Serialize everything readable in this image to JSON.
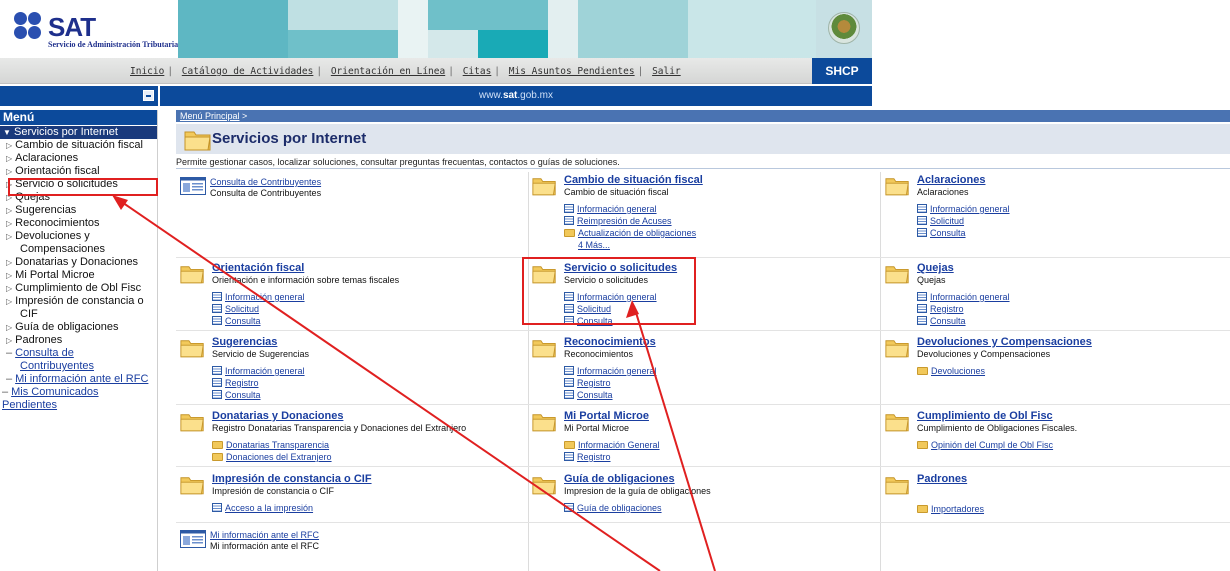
{
  "logo": {
    "name": "SAT",
    "subtitle": "Servicio de Administración Tributaria",
    "brand_color": "#1e2f8c"
  },
  "header": {
    "nav": [
      "Inicio",
      "Catálogo de Actividades",
      "Orientación en Línea",
      "Citas",
      "Mis Asuntos Pendientes",
      "Salir"
    ],
    "badge": "SHCP",
    "url_prefix": "www.",
    "url_brand": "sat",
    "url_suffix": ".gob.mx",
    "accent": "#0c4a9b"
  },
  "sidebar": {
    "title": "Menú",
    "section": "Servicios por Internet",
    "items": [
      "Cambio de situación fiscal",
      "Aclaraciones",
      "Orientación fiscal",
      "Servicio o solicitudes",
      "Quejas",
      "Sugerencias",
      "Reconocimientos",
      "Devoluciones y",
      "Compensaciones",
      "Donatarias y Donaciones",
      "Mi Portal Microe",
      "Cumplimiento de Obl Fisc",
      "Impresión de constancia o",
      "CIF",
      "Guía de obligaciones",
      "Padrones"
    ],
    "links": [
      "Consulta de",
      "Contribuyentes",
      "Mi información ante el RFC"
    ],
    "bottom_links": [
      "Mis Comunicados",
      "Pendientes"
    ]
  },
  "main": {
    "breadcrumb": "Menú Principal",
    "breadcrumb_sep": ">",
    "title": "Servicios por Internet",
    "description": "Permite gestionar casos, localizar soluciones, consultar preguntas frecuentas, contactos o guías de soluciones.",
    "cells": [
      {
        "title": "Consulta de Contribuyentes",
        "desc": "Consulta de Contribuyentes",
        "links": []
      },
      {
        "title": "Cambio de situación fiscal",
        "desc": "Cambio de situación fiscal",
        "links": [
          "Información general",
          "Reimpresión de Acuses",
          "Actualización de obligaciones"
        ],
        "more": "4 Más..."
      },
      {
        "title": "Aclaraciones",
        "desc": "Aclaraciones",
        "links": [
          "Información general",
          "Solicitud",
          "Consulta"
        ]
      },
      {
        "title": "Orientación fiscal",
        "desc": "Orientación e información sobre temas fiscales",
        "links": [
          "Información general",
          "Solicitud",
          "Consulta"
        ]
      },
      {
        "title": "Servicio o solicitudes",
        "desc": "Servicio o solicitudes",
        "links": [
          "Información general",
          "Solicitud",
          "Consulta"
        ]
      },
      {
        "title": "Quejas",
        "desc": "Quejas",
        "links": [
          "Información general",
          "Registro",
          "Consulta"
        ]
      },
      {
        "title": "Sugerencias",
        "desc": "Servicio de Sugerencias",
        "links": [
          "Información general",
          "Registro",
          "Consulta"
        ]
      },
      {
        "title": "Reconocimientos",
        "desc": "Reconocimientos",
        "links": [
          "Información general",
          "Registro",
          "Consulta"
        ]
      },
      {
        "title": "Devoluciones y Compensaciones",
        "desc": "Devoluciones y Compensaciones",
        "links": [
          "Devoluciones"
        ]
      },
      {
        "title": "Donatarias y Donaciones",
        "desc": "Registro Donatarias Transparencia y Donaciones del Extranjero",
        "links": [
          "Donatarias Transparencia",
          "Donaciones del Extranjero"
        ]
      },
      {
        "title": "Mi Portal Microe",
        "desc": "Mi Portal Microe",
        "links": [
          "Información General",
          "Registro"
        ]
      },
      {
        "title": "Cumplimiento de Obl Fisc",
        "desc": "Cumplimiento de Obligaciones Fiscales.",
        "links": [
          "Opinión del Cumpl de Obl Fisc"
        ]
      },
      {
        "title": "Impresión de constancia o CIF",
        "desc": "Impresión de constancia o CIF",
        "links": [
          "Acceso a la impresión"
        ]
      },
      {
        "title": "Guía de obligaciones",
        "desc": "Impresion de la guía de obligaciones",
        "links": [
          "Guía de obligaciones"
        ]
      },
      {
        "title": "Padrones",
        "desc": "",
        "links": [
          "Importadores"
        ]
      },
      {
        "title": "Mi información ante el RFC",
        "desc": "Mi información ante el RFC",
        "links": []
      }
    ]
  },
  "annotation_color": "#e02020"
}
